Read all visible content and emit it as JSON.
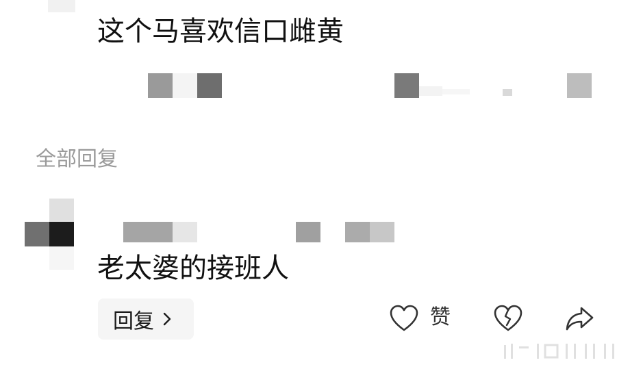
{
  "main_comment": {
    "text": "这个马喜欢信口雌黄"
  },
  "replies_section": {
    "label": "全部回复"
  },
  "reply": {
    "text": "老太婆的接班人",
    "reply_button_label": "回复",
    "like_label": "赞"
  },
  "icons": {
    "chevron": "chevron-right-icon",
    "like": "heart-icon",
    "dislike": "broken-heart-icon",
    "share": "share-icon"
  },
  "colors": {
    "text_primary": "#111111",
    "text_secondary": "#9a9a9a",
    "button_bg": "#f5f5f5"
  }
}
